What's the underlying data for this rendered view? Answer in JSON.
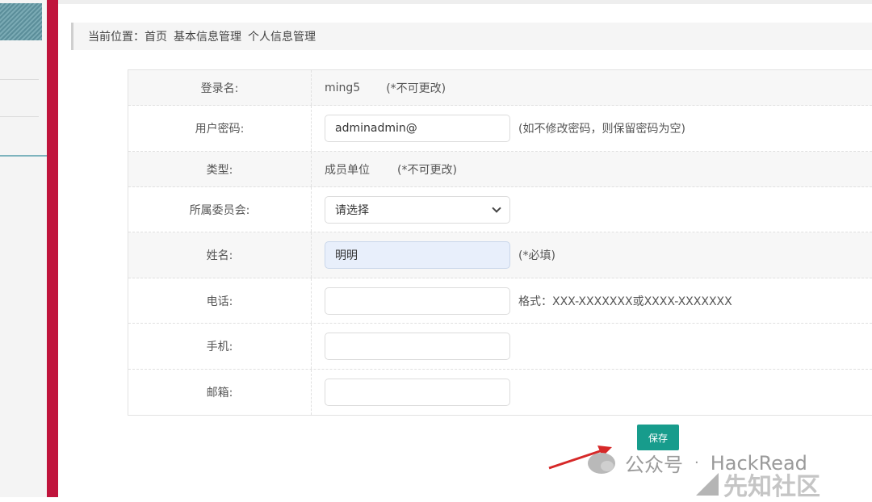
{
  "breadcrumb": {
    "prefix": "当前位置：",
    "items": [
      "首页",
      "基本信息管理",
      "个人信息管理"
    ]
  },
  "form": {
    "login": {
      "label": "登录名:",
      "value": "ming5",
      "hint": "(*不可更改)"
    },
    "password": {
      "label": "用户密码:",
      "value": "adminadmin@",
      "hint": "(如不修改密码，则保留密码为空)"
    },
    "type": {
      "label": "类型:",
      "value": "成员单位",
      "hint": "(*不可更改)"
    },
    "committee": {
      "label": "所属委员会:",
      "selected": "请选择"
    },
    "name": {
      "label": "姓名:",
      "value": "明明",
      "hint": "(*必填)"
    },
    "phone": {
      "label": "电话:",
      "value": "",
      "hint": "格式：XXX-XXXXXXX或XXXX-XXXXXXX"
    },
    "mobile": {
      "label": "手机:",
      "value": ""
    },
    "email": {
      "label": "邮箱:",
      "value": ""
    }
  },
  "save_label": "保存",
  "watermark": {
    "wechat": "公众号",
    "dot": "·",
    "brand": "HackRead",
    "site": "先知社区"
  },
  "colors": {
    "accent": "#179c8c",
    "sidebar_red": "#c0143c"
  }
}
